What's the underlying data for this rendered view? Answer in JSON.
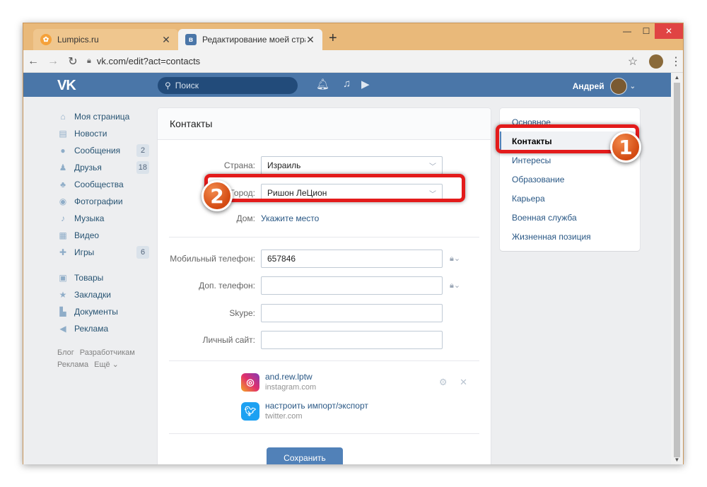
{
  "browser": {
    "tabs": [
      {
        "title": "Lumpics.ru",
        "close": "✕"
      },
      {
        "title": "Редактирование моей страницы",
        "close": "✕"
      }
    ],
    "new_tab": "+",
    "window_controls": {
      "minimize": "—",
      "maximize": "☐",
      "close": "✕"
    },
    "url": "vk.com/edit?act=contacts"
  },
  "vk": {
    "logo": "VK",
    "search_placeholder": "Поиск",
    "user_name": "Андрей"
  },
  "left_nav": {
    "items": [
      {
        "label": "Моя страница",
        "count": ""
      },
      {
        "label": "Новости",
        "count": ""
      },
      {
        "label": "Сообщения",
        "count": "2"
      },
      {
        "label": "Друзья",
        "count": "18"
      },
      {
        "label": "Сообщества",
        "count": ""
      },
      {
        "label": "Фотографии",
        "count": ""
      },
      {
        "label": "Музыка",
        "count": ""
      },
      {
        "label": "Видео",
        "count": ""
      },
      {
        "label": "Игры",
        "count": "6"
      }
    ],
    "items2": [
      {
        "label": "Товары"
      },
      {
        "label": "Закладки"
      },
      {
        "label": "Документы"
      },
      {
        "label": "Реклама"
      }
    ],
    "footer": [
      "Блог",
      "Разработчикам",
      "Реклама",
      "Ещё ⌄"
    ]
  },
  "contacts": {
    "title": "Контакты",
    "country_label": "Страна:",
    "country_value": "Израиль",
    "city_label": "Город:",
    "city_value": "Ришон ЛеЦион",
    "home_label": "Дом:",
    "home_link": "Укажите место",
    "mobile_label": "Мобильный телефон:",
    "mobile_value": "657846",
    "extra_phone_label": "Доп. телефон:",
    "extra_phone_value": "",
    "skype_label": "Skype:",
    "skype_value": "",
    "site_label": "Личный сайт:",
    "site_value": "",
    "instagram": {
      "account": "and.rew.lptw",
      "domain": "instagram.com"
    },
    "twitter": {
      "action": "настроить импорт/экспорт",
      "domain": "twitter.com"
    },
    "save_label": "Сохранить"
  },
  "right_nav": {
    "items": [
      "Основное",
      "Контакты",
      "Интересы",
      "Образование",
      "Карьера",
      "Военная служба",
      "Жизненная позиция"
    ],
    "active": "Контакты"
  },
  "annotations": {
    "badge1": "1",
    "badge2": "2"
  },
  "colors": {
    "vk_blue": "#4a76a8",
    "highlight_red": "#e31b1b",
    "badge_orange": "#d34a12",
    "window_frame": "#e9b97a"
  }
}
